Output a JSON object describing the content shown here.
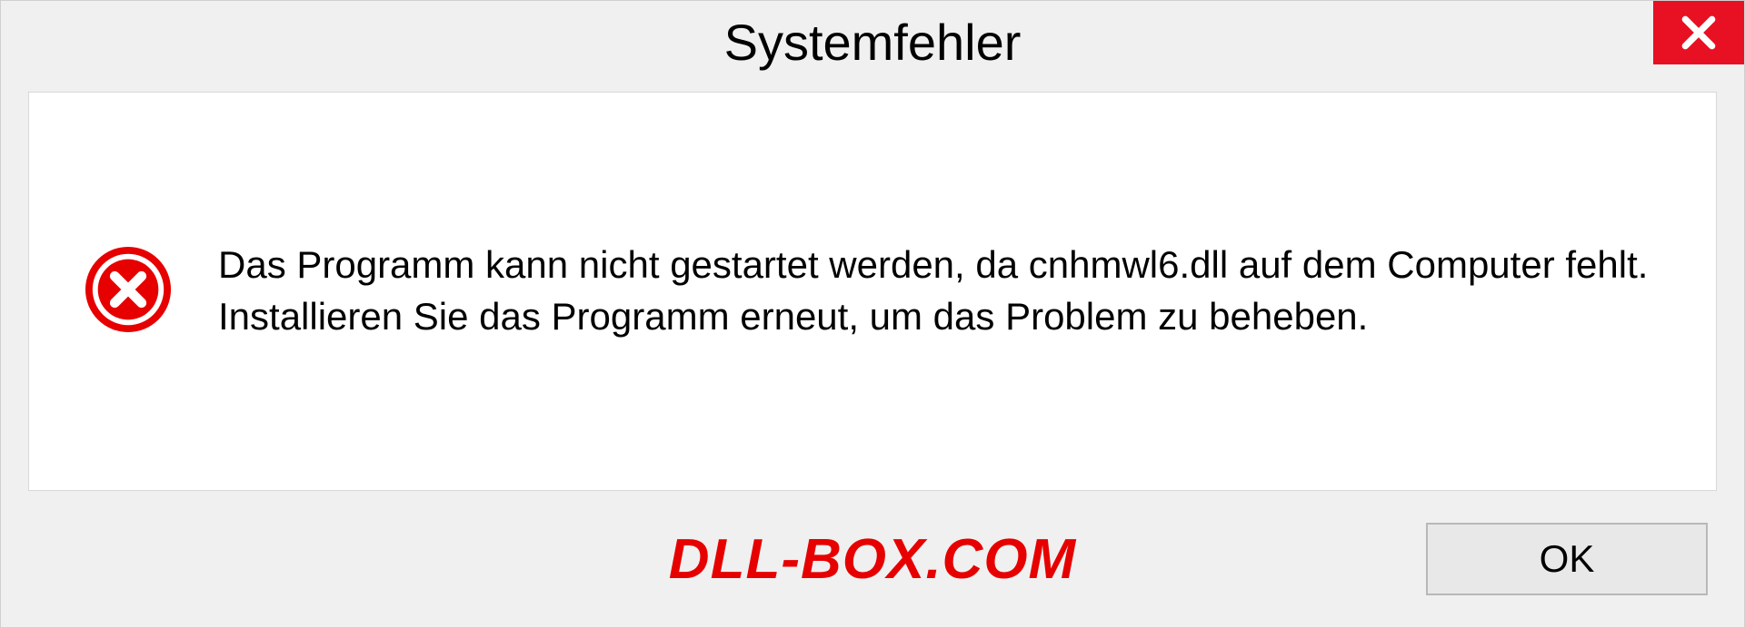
{
  "dialog": {
    "title": "Systemfehler",
    "message": "Das Programm kann nicht gestartet werden, da cnhmwl6.dll auf dem Computer fehlt. Installieren Sie das Programm erneut, um das Problem zu beheben.",
    "ok_label": "OK"
  },
  "watermark": "DLL-BOX.COM"
}
